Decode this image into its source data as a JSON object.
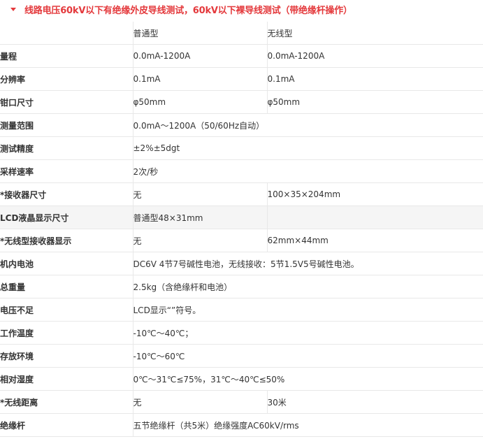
{
  "header": {
    "title": "线路电压60kV以下有绝缘外皮导线测试，60kV以下裸导线测试（带绝缘杆操作）"
  },
  "table": {
    "columns": [
      "",
      "普通型",
      "无线型"
    ],
    "rows": [
      {
        "label": "量程",
        "v1": "0.0mA-1200A",
        "v2": "0.0mA-1200A"
      },
      {
        "label": "分辨率",
        "v1": "0.1mA",
        "v2": "0.1mA"
      },
      {
        "label": "钳口尺寸",
        "v1": "φ50mm",
        "v2": "φ50mm"
      },
      {
        "label": "测量范围",
        "value": "0.0mA～1200A（50/60Hz自动）"
      },
      {
        "label": "测试精度",
        "value": "±2%±5dgt"
      },
      {
        "label": "采样速率",
        "value": "2次/秒"
      },
      {
        "label": "*接收器尺寸",
        "v1": "无",
        "v2": "100×35×204mm"
      },
      {
        "label": "LCD液晶显示尺寸",
        "v1": "普通型48×31mm",
        "v2": ""
      },
      {
        "label": "*无线型接收器显示",
        "v1": "无",
        "v2": "62mm×44mm"
      },
      {
        "label": "机内电池",
        "value": "DC6V 4节7号碱性电池，无线接收：5节1.5V5号碱性电池。"
      },
      {
        "label": "总重量",
        "value": "2.5kg（含绝缘杆和电池）"
      },
      {
        "label": "电压不足",
        "value": "LCD显示“”符号。"
      },
      {
        "label": "工作温度",
        "value": "-10℃～40℃；"
      },
      {
        "label": "存放环境",
        "value": "-10℃～60℃"
      },
      {
        "label": "相对湿度",
        "value": "0℃～31℃≤75%，31℃～40℃≤50%"
      },
      {
        "label": "*无线距离",
        "v1": "无",
        "v2": "30米"
      },
      {
        "label": "绝缘杆",
        "value": "五节绝缘杆（共5米）绝缘强度AC60kV/rms"
      }
    ]
  },
  "colors": {
    "accent": "#e4393c",
    "border": "#e8e8e8",
    "shaded_row": "#f5f5f5"
  }
}
